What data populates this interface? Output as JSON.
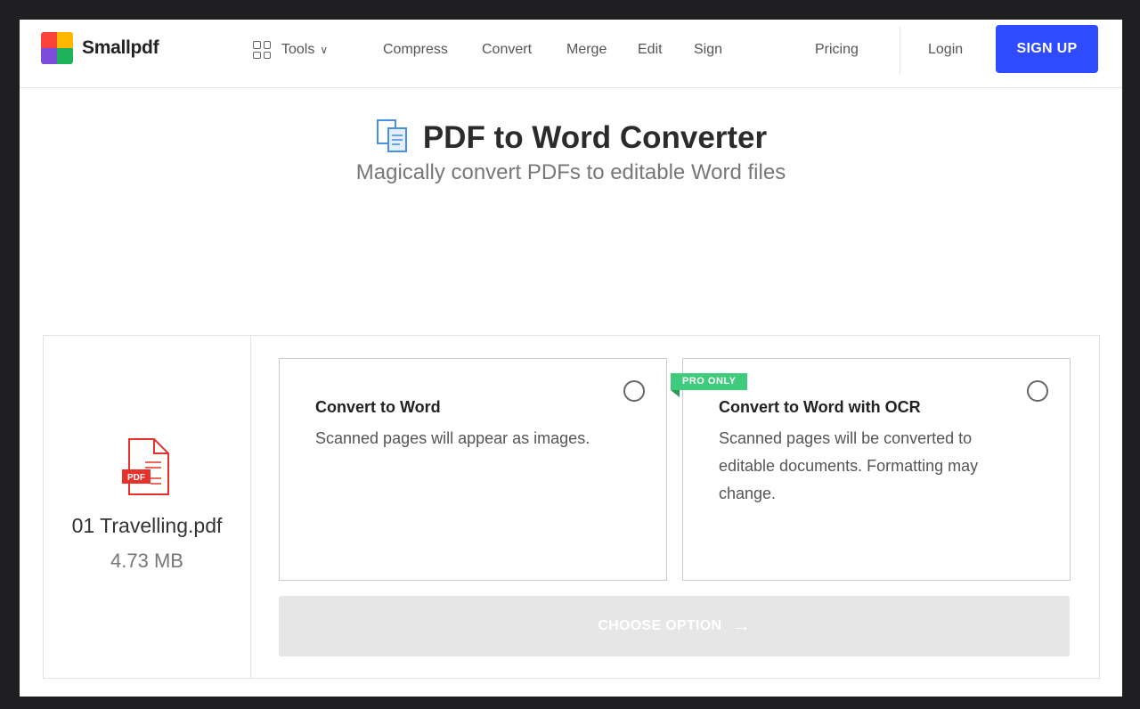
{
  "brand": {
    "name": "Smallpdf",
    "logo_colors": [
      "#f9423a",
      "#ffb700",
      "#1fb25a",
      "#7d4cdb"
    ]
  },
  "nav": {
    "tools_label": "Tools",
    "links": [
      "Compress",
      "Convert",
      "Merge",
      "Edit",
      "Sign"
    ],
    "pricing": "Pricing",
    "login": "Login",
    "signup": "SIGN UP"
  },
  "page": {
    "title": "PDF to Word Converter",
    "subtitle": "Magically convert PDFs to editable Word files"
  },
  "file": {
    "badge": "PDF",
    "name": "01 Travelling.pdf",
    "size": "4.73 MB"
  },
  "options": [
    {
      "title": "Convert to Word",
      "description": "Scanned pages will appear as images.",
      "selected": false
    },
    {
      "badge": "PRO ONLY",
      "title": "Convert to Word with OCR",
      "description": "Scanned pages will be converted to editable documents. Formatting may change.",
      "selected": false
    }
  ],
  "action": {
    "label": "CHOOSE OPTION",
    "arrow": "→"
  },
  "colors": {
    "accent": "#2f4bff",
    "pro_badge": "#3ecb7c",
    "pdf_red": "#e5322d"
  }
}
